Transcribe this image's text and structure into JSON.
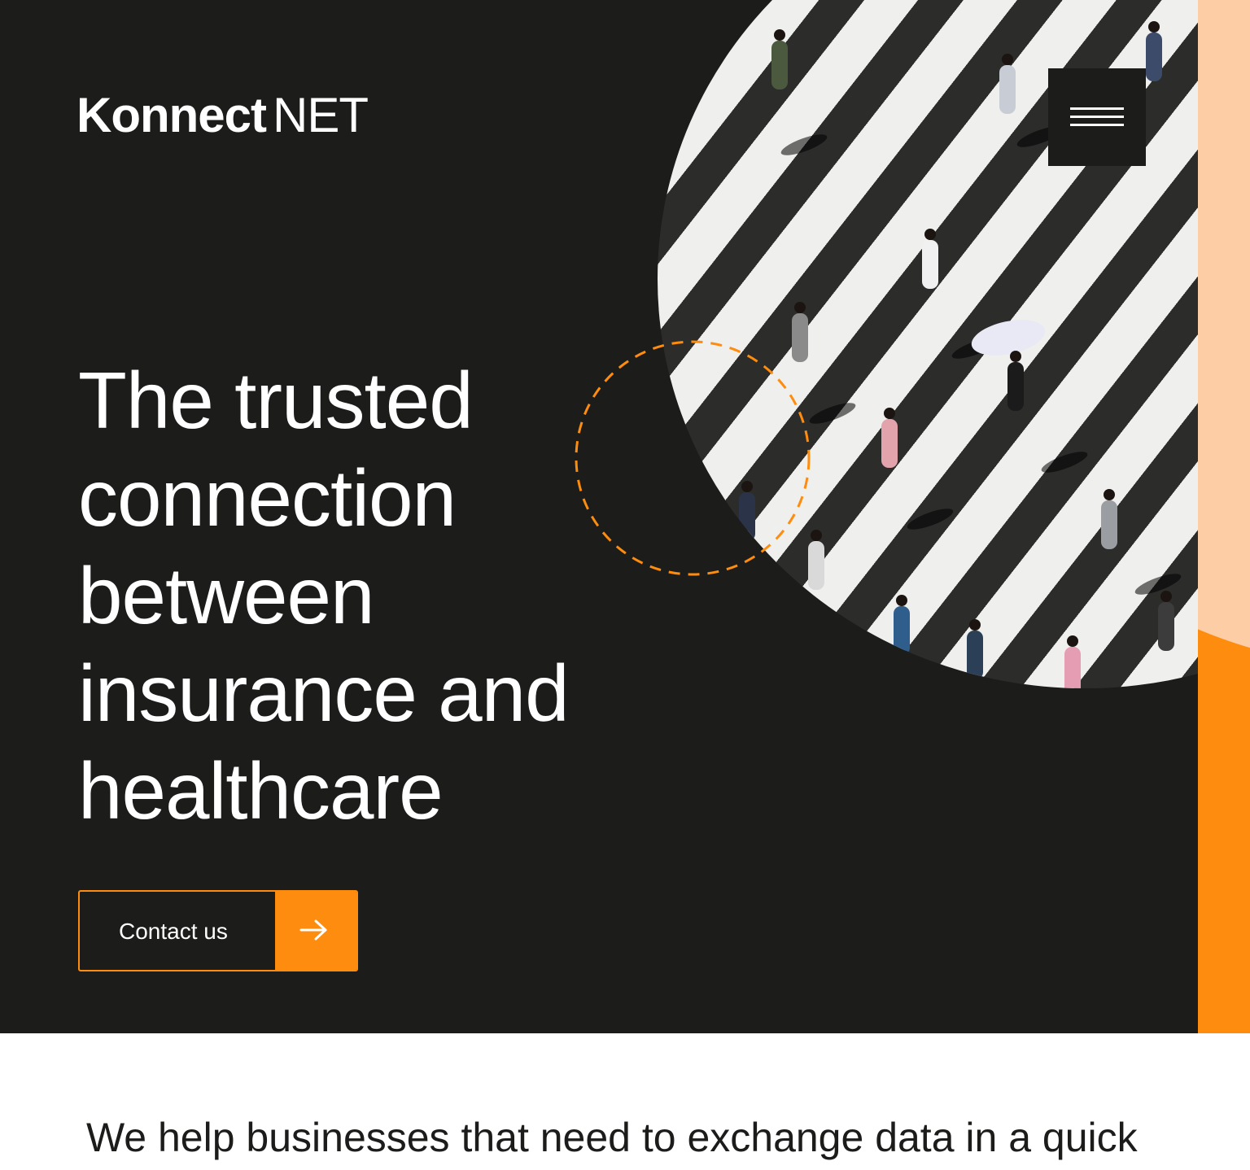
{
  "brand": {
    "logo_bold": "Konnect",
    "logo_thin": "NET"
  },
  "header": {
    "menu_icon": "hamburger-menu-icon"
  },
  "hero": {
    "headline": "The trusted connection between insurance and healthcare",
    "cta_label": "Contact us",
    "cta_icon": "arrow-right-icon",
    "image_description_icon": "crosswalk-photo"
  },
  "intro": {
    "text": "We help businesses that need to exchange data in a quick"
  },
  "colors": {
    "background_dark": "#1c1d1b",
    "accent_orange": "#fe8c0e",
    "accent_peach": "#fdcea6",
    "text_light": "#ffffff",
    "text_dark": "#1c1d1b"
  }
}
